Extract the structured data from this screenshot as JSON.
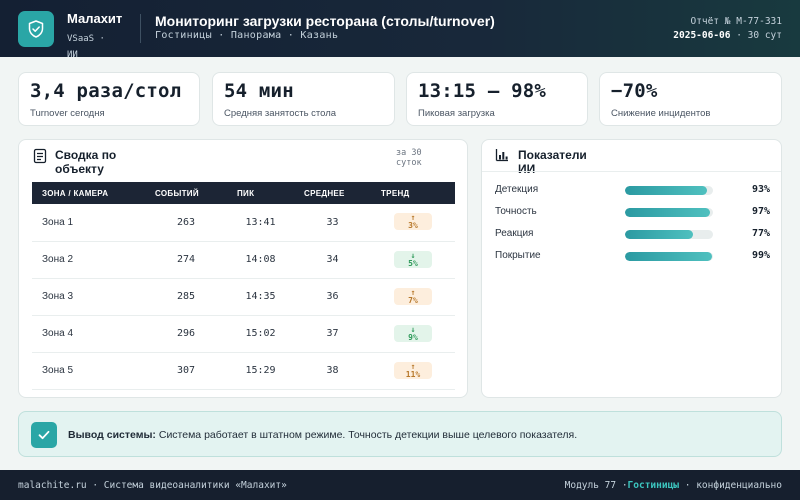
{
  "header": {
    "brand_name": "Малахит",
    "brand_sub": "VSaaS · ИИ",
    "title": "Мониторинг загрузки ресторана (столы/turnover)",
    "subtitle": "Гостиницы · Панорама · Казань",
    "report_label": "Отчёт № М-77-331",
    "report_date": "2025-06-06",
    "report_period": "· 30 сут"
  },
  "kpis": [
    {
      "value": "3,4 раза/стол",
      "label": "Turnover сегодня"
    },
    {
      "value": "54 мин",
      "label": "Средняя занятость стола"
    },
    {
      "value": "13:15 — 98%",
      "label": "Пиковая загрузка"
    },
    {
      "value": "−70%",
      "label": "Снижение инцидентов"
    }
  ],
  "summary": {
    "title": "Сводка по объекту",
    "period": "за 30 суток",
    "columns": [
      "ЗОНА / КАМЕРА",
      "СОБЫТИЙ",
      "ПИК",
      "СРЕДНЕЕ",
      "ТРЕНД"
    ],
    "rows": [
      {
        "zone": "Зона 1",
        "events": "263",
        "peak": "13:41",
        "avg": "33",
        "trend_arrow": "↑",
        "trend": "3%",
        "dir": "up"
      },
      {
        "zone": "Зона 2",
        "events": "274",
        "peak": "14:08",
        "avg": "34",
        "trend_arrow": "↓",
        "trend": "5%",
        "dir": "down"
      },
      {
        "zone": "Зона 3",
        "events": "285",
        "peak": "14:35",
        "avg": "36",
        "trend_arrow": "↑",
        "trend": "7%",
        "dir": "up"
      },
      {
        "zone": "Зона 4",
        "events": "296",
        "peak": "15:02",
        "avg": "37",
        "trend_arrow": "↓",
        "trend": "9%",
        "dir": "down"
      },
      {
        "zone": "Зона 5",
        "events": "307",
        "peak": "15:29",
        "avg": "38",
        "trend_arrow": "↑",
        "trend": "11%",
        "dir": "up"
      }
    ]
  },
  "ai": {
    "title": "Показатели ИИ",
    "metrics": [
      {
        "label": "Детекция",
        "value": 93,
        "text": "93%"
      },
      {
        "label": "Точность",
        "value": 97,
        "text": "97%"
      },
      {
        "label": "Реакция",
        "value": 77,
        "text": "77%"
      },
      {
        "label": "Покрытие",
        "value": 99,
        "text": "99%"
      }
    ]
  },
  "conclusion": {
    "label": "Вывод системы:",
    "text": "Система работает в штатном режиме. Точность детекции выше целевого показателя."
  },
  "footer": {
    "left": "malachite.ru · Система видеоаналитики «Малахит»",
    "module": "Модуль 77 ·",
    "segment": "Гостиницы",
    "confidential": "· конфиденциально"
  },
  "colors": {
    "accent": "#2aa6a6",
    "header_bg": "#142033",
    "trend_up": "#b7782a",
    "trend_down": "#2f9a5a"
  }
}
